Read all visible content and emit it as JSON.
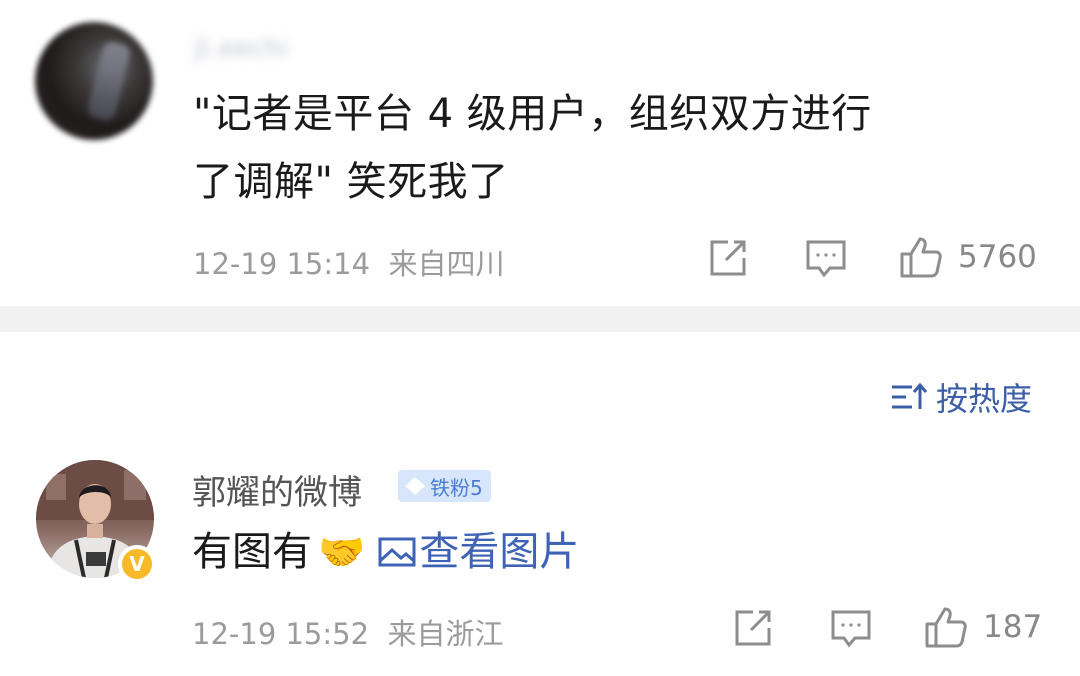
{
  "comment1": {
    "author_blurred": "Ji.eechi",
    "text_line1": "\"记者是平台 4 级用户，组织双方进行",
    "text_line2": "了调解\" 笑死我了",
    "time": "12-19 15:14",
    "location": "来自四川",
    "likes": "5760"
  },
  "sort": {
    "label": "按热度",
    "icon": "sort-icon"
  },
  "comment2": {
    "author": "郭耀的微博",
    "badge": "铁粉5",
    "verified_mark": "V",
    "text": "有图有",
    "emoji": "🤝",
    "link_text": "查看图片",
    "time": "12-19 15:52",
    "location": "来自浙江",
    "likes": "187"
  },
  "colors": {
    "link": "#3f63b4",
    "meta": "#9b9b9b",
    "badge_bg": "#d7e6fb",
    "verified": "#f7b928",
    "divider": "#f1f1f1"
  }
}
